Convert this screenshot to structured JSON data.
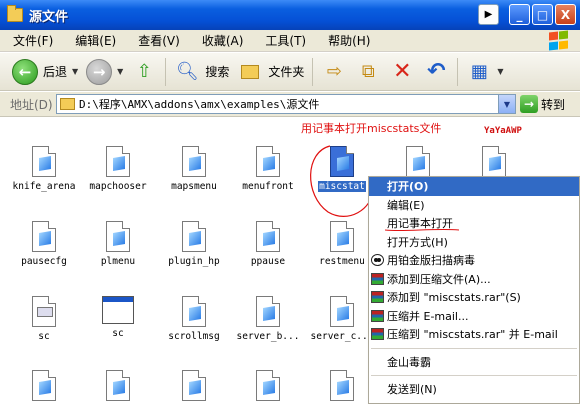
{
  "window": {
    "title": "源文件",
    "minimize": "_",
    "maximize": "□",
    "close": "X"
  },
  "menubar": [
    "文件(F)",
    "编辑(E)",
    "查看(V)",
    "收藏(A)",
    "工具(T)",
    "帮助(H)"
  ],
  "toolbar": {
    "back": "后退",
    "search": "搜索",
    "folders": "文件夹"
  },
  "address": {
    "label": "地址(D)",
    "path": "D:\\程序\\AMX\\addons\\amx\\examples\\源文件",
    "go": "转到"
  },
  "files": [
    {
      "name": "knife_arena",
      "icon": "document"
    },
    {
      "name": "mapchooser",
      "icon": "document"
    },
    {
      "name": "mapsmenu",
      "icon": "document"
    },
    {
      "name": "menufront",
      "icon": "document"
    },
    {
      "name": "miscstat",
      "icon": "document",
      "selected": true
    },
    {
      "name": "pausecfg",
      "icon": "document"
    },
    {
      "name": "plmenu",
      "icon": "document"
    },
    {
      "name": "plugin_hp",
      "icon": "document"
    },
    {
      "name": "ppause",
      "icon": "document"
    },
    {
      "name": "restmenu",
      "icon": "document"
    },
    {
      "name": "sc",
      "icon": "dll"
    },
    {
      "name": "sc",
      "icon": "window"
    },
    {
      "name": "scrollmsg",
      "icon": "document"
    },
    {
      "name": "server_b...",
      "icon": "document"
    },
    {
      "name": "server_c...",
      "icon": "document"
    }
  ],
  "annotation": {
    "note": "用记事本打开miscstats文件",
    "author": "YaYaAWP"
  },
  "context_menu": {
    "items": [
      {
        "label": "打开(O)",
        "bold": true,
        "highlight": true,
        "icon": ""
      },
      {
        "label": "编辑(E)",
        "icon": ""
      },
      {
        "label": "用记事本打开",
        "icon": ""
      },
      {
        "label": "打开方式(H)",
        "icon": ""
      },
      {
        "label": "用铂金版扫描病毒",
        "icon": "panda-icon"
      },
      {
        "label": "添加到压缩文件(A)...",
        "icon": "rar-icon"
      },
      {
        "label": "添加到 \"miscstats.rar\"(S)",
        "icon": "rar-icon"
      },
      {
        "label": "压缩并 E-mail...",
        "icon": "rar-icon"
      },
      {
        "label": "压缩到 \"miscstats.rar\" 并 E-mail",
        "icon": "rar-icon"
      },
      {
        "separator": true
      },
      {
        "label": "金山毒霸",
        "icon": ""
      },
      {
        "separator": true
      },
      {
        "label": "发送到(N)",
        "icon": ""
      }
    ]
  }
}
